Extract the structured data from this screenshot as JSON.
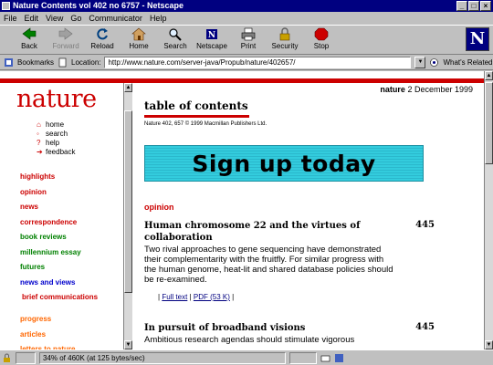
{
  "window": {
    "title": "Nature Contents vol 402 no 6757 - Netscape"
  },
  "menu": [
    "File",
    "Edit",
    "View",
    "Go",
    "Communicator",
    "Help"
  ],
  "toolbar": {
    "back": "Back",
    "forward": "Forward",
    "reload": "Reload",
    "home": "Home",
    "search": "Search",
    "netscape": "Netscape",
    "print": "Print",
    "security": "Security",
    "stop": "Stop"
  },
  "location": {
    "bookmarks_label": "Bookmarks",
    "location_label": "Location:",
    "url": "http://www.nature.com/server-java/Propub/nature/402657/",
    "whats_related": "What's Related"
  },
  "page": {
    "brand": "nature",
    "utility": [
      "home",
      "search",
      "help",
      "feedback"
    ],
    "nav": [
      {
        "label": "highlights",
        "color": "#cc0000"
      },
      {
        "label": "opinion",
        "color": "#cc0000"
      },
      {
        "label": "news",
        "color": "#cc0000"
      },
      {
        "label": "correspondence",
        "color": "#cc0000"
      },
      {
        "label": "book reviews",
        "color": "#008000"
      },
      {
        "label": "millennium essay",
        "color": "#008000"
      },
      {
        "label": "futures",
        "color": "#008000"
      },
      {
        "label": "news and views",
        "color": "#0000cc"
      },
      {
        "label": "brief communications",
        "color": "#cc0000"
      },
      {
        "label": "progress",
        "color": "#ff6600"
      },
      {
        "label": "articles",
        "color": "#ff6600"
      },
      {
        "label": "letters to nature",
        "color": "#ff6600"
      }
    ],
    "issue_brand": "nature",
    "issue_date": "2 December 1999",
    "toc_title": "table of contents",
    "copyright": "Nature 402, 657 © 1999 Macmillan Publishers Ltd.",
    "banner": "Sign up today",
    "section": "opinion",
    "articles": [
      {
        "title": "Human chromosome 22 and the virtues of collaboration",
        "page": "445",
        "abstract": "Two rival approaches to gene sequencing have demonstrated their complementarity with the fruitfly. For similar progress with the human genome, heat-lit and shared database policies should be re-examined.",
        "full_text": "Full text",
        "pdf": "PDF (53 K)"
      },
      {
        "title": "In pursuit of broadband visions",
        "page": "445",
        "abstract": "Ambitious research agendas should stimulate vigorous"
      }
    ]
  },
  "status": {
    "text": "34% of 460K (at 125 bytes/sec)"
  }
}
